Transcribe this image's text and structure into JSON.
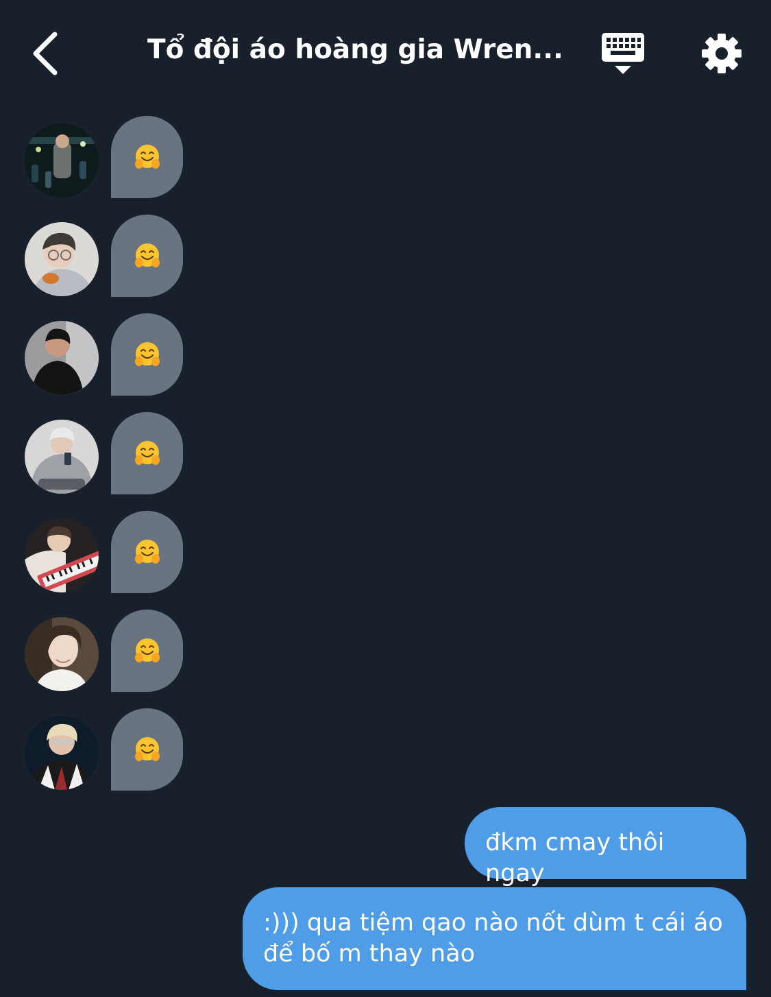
{
  "header": {
    "title": "Tổ đội áo hoàng gia Wren...",
    "back_icon": "chevron-left-icon",
    "keyboard_icon": "keyboard-icon",
    "settings_icon": "gear-icon"
  },
  "messages_in": [
    {
      "avatar": "avatar-1",
      "content_icon": "hugging-face-emoji"
    },
    {
      "avatar": "avatar-2",
      "content_icon": "hugging-face-emoji"
    },
    {
      "avatar": "avatar-3",
      "content_icon": "hugging-face-emoji"
    },
    {
      "avatar": "avatar-4",
      "content_icon": "hugging-face-emoji"
    },
    {
      "avatar": "avatar-5",
      "content_icon": "hugging-face-emoji"
    },
    {
      "avatar": "avatar-6",
      "content_icon": "hugging-face-emoji"
    },
    {
      "avatar": "avatar-7",
      "content_icon": "hugging-face-emoji"
    }
  ],
  "messages_out": [
    {
      "line1": "đkm cmay thôi ngay"
    },
    {
      "line1": ":))) qua tiệm qao nào nốt dùm t cái áo",
      "line2": "để bố m thay nào"
    }
  ],
  "colors": {
    "background": "#18202c",
    "incoming_bubble": "#6a7480",
    "outgoing_bubble": "#4f9de6"
  }
}
